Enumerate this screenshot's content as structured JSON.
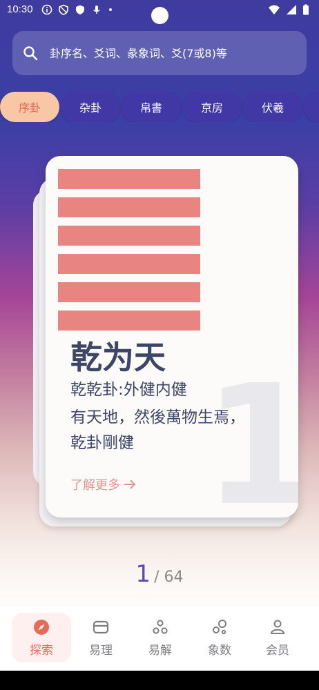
{
  "status_bar": {
    "time": "10:30"
  },
  "search": {
    "placeholder": "卦序名、爻词、彖象词、爻(7或8)等"
  },
  "tabs": [
    {
      "label": "序卦",
      "active": true
    },
    {
      "label": "杂卦",
      "active": false
    },
    {
      "label": "帛書",
      "active": false
    },
    {
      "label": "京房",
      "active": false
    },
    {
      "label": "伏羲",
      "active": false
    }
  ],
  "card": {
    "name": "乾为天",
    "subtitle": "乾乾卦:外健内健",
    "line1": "有天地，然後萬物生焉，",
    "line2": "乾卦剛健",
    "more_label": "了解更多",
    "index": "1",
    "yao_color": "#e88580"
  },
  "pager": {
    "current": "1",
    "total": "/ 64"
  },
  "bottom_nav": [
    {
      "label": "探索",
      "icon": "compass-icon",
      "active": true
    },
    {
      "label": "易理",
      "icon": "wallet-icon",
      "active": false
    },
    {
      "label": "易解",
      "icon": "dots-icon",
      "active": false
    },
    {
      "label": "象数",
      "icon": "circles-icon",
      "active": false
    },
    {
      "label": "会员",
      "icon": "user-icon",
      "active": false
    }
  ],
  "colors": {
    "accent": "#e76c58",
    "tab_bg": "#4137a5",
    "tab_active_bg": "#f9c6a6"
  }
}
